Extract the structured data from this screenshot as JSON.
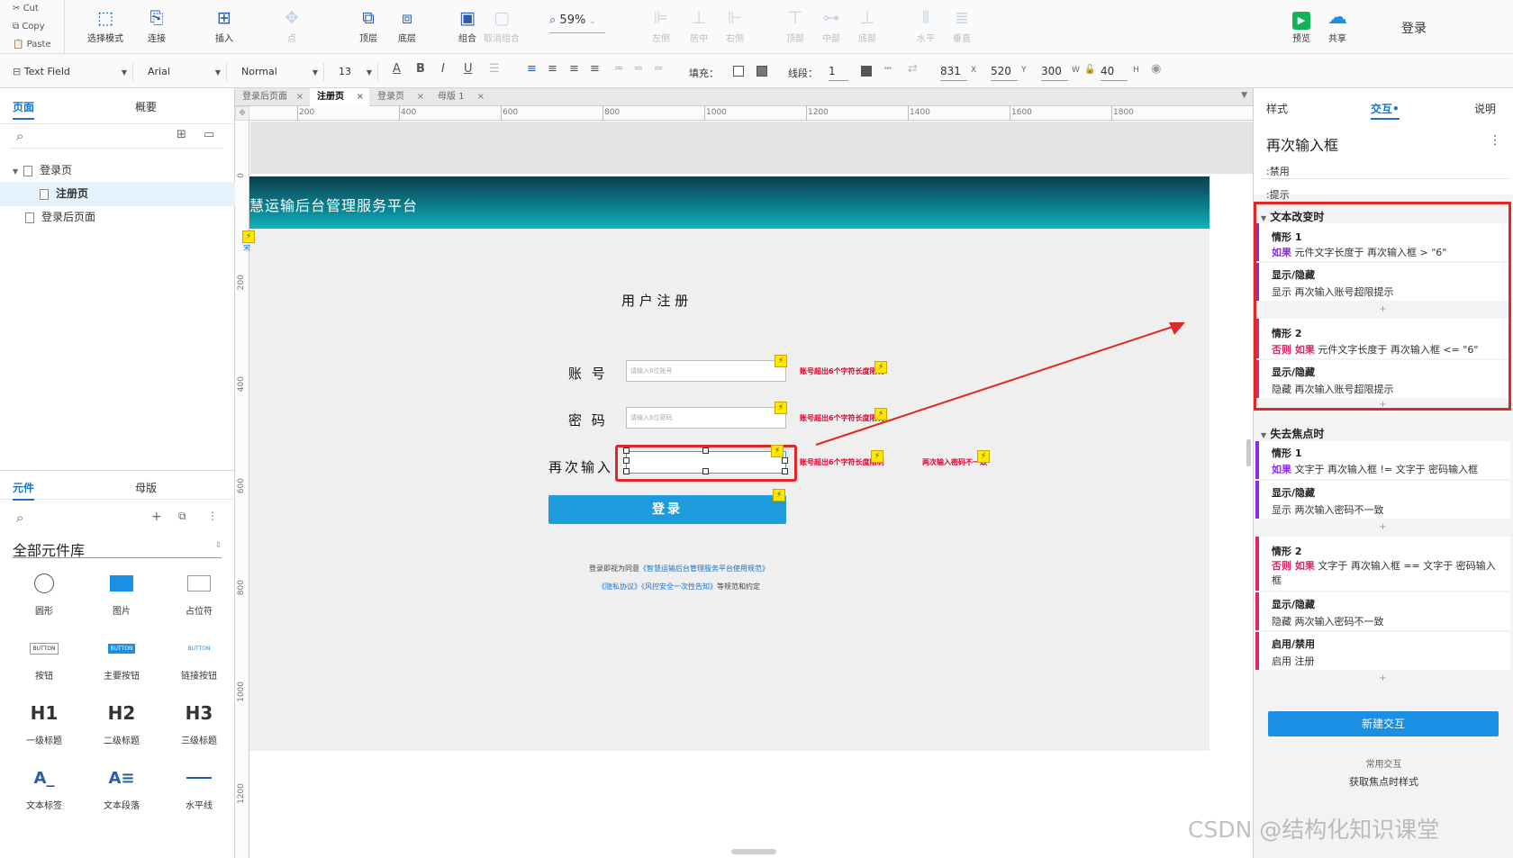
{
  "clipboard": {
    "cut": "Cut",
    "copy": "Copy",
    "paste": "Paste"
  },
  "toolbar": [
    {
      "id": "select",
      "label": "选择模式",
      "icon": "⬚",
      "dis": false
    },
    {
      "id": "connect",
      "label": "连接",
      "icon": "⎘",
      "dis": false
    },
    {
      "id": "insert",
      "label": "插入",
      "icon": "⊞",
      "dis": false
    },
    {
      "id": "point",
      "label": "点",
      "icon": "✥",
      "dis": true
    },
    {
      "id": "top",
      "label": "顶层",
      "icon": "⧉",
      "dis": false
    },
    {
      "id": "bottom",
      "label": "底层",
      "icon": "⧈",
      "dis": false
    },
    {
      "id": "group",
      "label": "组合",
      "icon": "▣",
      "dis": false
    },
    {
      "id": "ungroup",
      "label": "取消组合",
      "icon": "▢",
      "dis": true
    },
    {
      "id": "left",
      "label": "左侧",
      "icon": "⊫",
      "dis": true
    },
    {
      "id": "center",
      "label": "居中",
      "icon": "⊥",
      "dis": true
    },
    {
      "id": "right",
      "label": "右侧",
      "icon": "⊩",
      "dis": true
    },
    {
      "id": "top2",
      "label": "顶部",
      "icon": "⊤",
      "dis": true
    },
    {
      "id": "middle",
      "label": "中部",
      "icon": "⊶",
      "dis": true
    },
    {
      "id": "bottom2",
      "label": "底部",
      "icon": "⊥",
      "dis": true
    },
    {
      "id": "horizontal",
      "label": "水平",
      "icon": "⦀",
      "dis": true
    },
    {
      "id": "vertical",
      "label": "垂直",
      "icon": "≣",
      "dis": true
    }
  ],
  "zoom": "59%",
  "preview": "预览",
  "share": "共享",
  "login": "登录",
  "format": {
    "widget_type": "Text Field",
    "font": "Arial",
    "style": "Normal",
    "size": "13",
    "fill": "填充：",
    "line": "线段：",
    "line_val": "1",
    "x": "831",
    "y": "520",
    "w": "300",
    "h": "40",
    "xl": "X",
    "yl": "Y",
    "wl": "W",
    "hl": "H"
  },
  "left": {
    "tab_pages": "页面",
    "tab_outline": "概要",
    "pages": [
      "登录页",
      "注册页",
      "登录后页面"
    ],
    "tab_widgets": "元件",
    "tab_masters": "母版",
    "library": "全部元件库",
    "widgets": [
      {
        "n": "圆形"
      },
      {
        "n": "图片"
      },
      {
        "n": "占位符"
      },
      {
        "n": "按钮",
        "g": "BUTTON"
      },
      {
        "n": "主要按钮",
        "g": "BUTTON"
      },
      {
        "n": "链接按钮",
        "g": "BUTTON"
      },
      {
        "n": "一级标题",
        "g": "H1"
      },
      {
        "n": "二级标题",
        "g": "H2"
      },
      {
        "n": "三级标题",
        "g": "H3"
      },
      {
        "n": "文本标签",
        "g": "A_"
      },
      {
        "n": "文本段落",
        "g": "A≡"
      },
      {
        "n": "水平线"
      }
    ]
  },
  "doctabs": [
    "登录后页面",
    "注册页",
    "登录页",
    "母版 1"
  ],
  "ruler_h": [
    "200",
    "400",
    "600",
    "800",
    "1000",
    "1200",
    "1400",
    "1600",
    "1800"
  ],
  "ruler_v": [
    "0",
    "200",
    "400",
    "600",
    "800",
    "1000",
    "1200"
  ],
  "design": {
    "header_title": "慧运输后台管理服务平台",
    "form_title": "用 户 注 册",
    "account": "账 号",
    "password": "密 码",
    "again": "再次输入",
    "account_ph": "请输入6位账号",
    "password_ph": "请输入6位密码",
    "note1": "账号超出6个字符长度限制",
    "note2": "账号超出6个字符长度限制",
    "note3": "账号超出6个字符长度限制",
    "note4": "两次输入密码不一致",
    "login_btn": "登录",
    "footer1a": "登录即视为同意",
    "footer1b": "《智慧运输后台管理服务平台使用规范》",
    "footer2a": "《隐私协议》《风控安全一次性告知》",
    "footer2b": "等规范和约定",
    "side_tag": "宋"
  },
  "right": {
    "tab_style": "样式",
    "tab_interact": "交互",
    "tab_notes": "说明",
    "widget_name": "再次输入框",
    "disabled": ":禁用",
    "hint": ":提示",
    "ev1": "文本改变时",
    "c1t": "情形 1",
    "c1if": "如果",
    "c1cond": " 元件文字长度于 再次输入框 > \"6\"",
    "c1a": "显示/隐藏",
    "c1ad": "显示 再次输入账号超限提示",
    "c2t": "情形 2",
    "c2if": "否则 如果",
    "c2cond": " 元件文字长度于 再次输入框 <= \"6\"",
    "c2a": "显示/隐藏",
    "c2ad": "隐藏 再次输入账号超限提示",
    "ev2": "失去焦点时",
    "d1t": "情形 1",
    "d1if": "如果",
    "d1cond": " 文字于 再次输入框 != 文字于 密码输入框",
    "d1a": "显示/隐藏",
    "d1ad": "显示 两次输入密码不一致",
    "d2t": "情形 2",
    "d2if": "否则 如果",
    "d2cond": " 文字于 再次输入框 == 文字于 密码输入框",
    "d2a": "显示/隐藏",
    "d2ad": "隐藏 两次输入密码不一致",
    "d2b": "启用/禁用",
    "d2bd": "启用 注册",
    "new_btn": "新建交互",
    "common": "常用交互",
    "common2": "获取焦点时样式"
  },
  "watermark": "CSDN @结构化知识课堂",
  "colors": {
    "accent": "#1a73c9",
    "highlight": "#e02828",
    "header": "#0d8c9a",
    "login": "#1c9cdc"
  }
}
